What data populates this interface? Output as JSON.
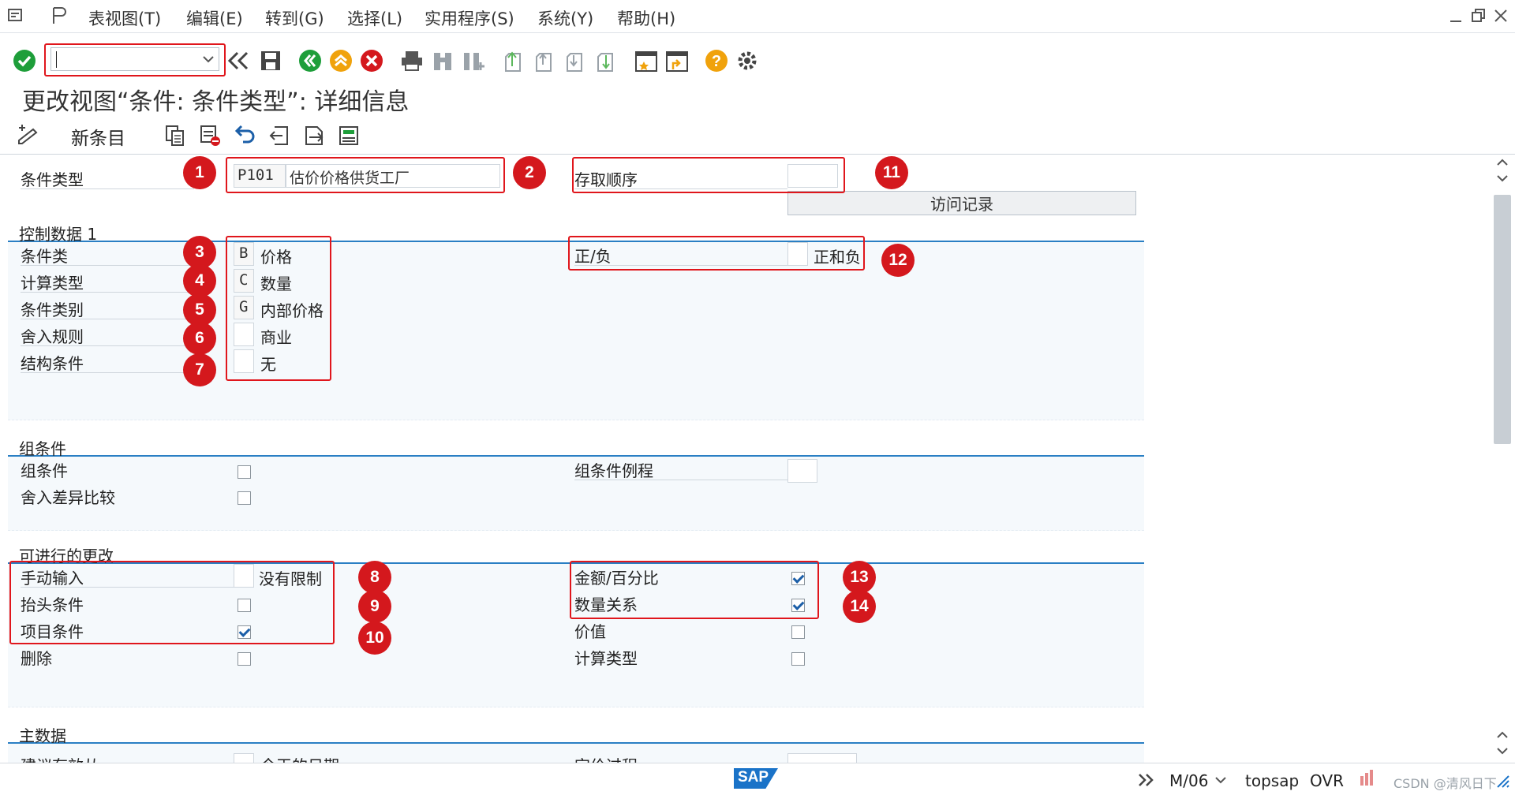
{
  "menubar": {
    "items": [
      "表视图(T)",
      "编辑(E)",
      "转到(G)",
      "选择(L)",
      "实用程序(S)",
      "系统(Y)",
      "帮助(H)"
    ]
  },
  "toolbar": {
    "icons": [
      "check-icon",
      "back-icon",
      "save-icon",
      "nav-back-icon",
      "exit-icon",
      "cancel-icon",
      "print-icon",
      "find-icon",
      "find-next-icon",
      "first-page-icon",
      "prev-page-icon",
      "next-page-icon",
      "last-page-icon",
      "new-session-icon",
      "shortcut-icon",
      "help-icon",
      "settings-icon"
    ],
    "command_value": ""
  },
  "title": "更改视图“条件: 条件类型”: 详细信息",
  "app_toolbar": {
    "new_entry": "新条目"
  },
  "header_fields": {
    "condition_type_label": "条件类型",
    "condition_type_code": "P101",
    "condition_type_desc": "估价价格供货工厂",
    "access_seq_label": "存取顺序",
    "access_seq_value": "",
    "access_records_btn": "访问记录"
  },
  "control_data_1": {
    "title": "控制数据 1",
    "rows": [
      {
        "label": "条件类",
        "code": "B",
        "text": "价格"
      },
      {
        "label": "计算类型",
        "code": "C",
        "text": "数量"
      },
      {
        "label": "条件类别",
        "code": "G",
        "text": "内部价格"
      },
      {
        "label": "舍入规则",
        "code": "",
        "text": "商业"
      },
      {
        "label": "结构条件",
        "code": "",
        "text": "无"
      }
    ],
    "plus_minus_label": "正/负",
    "plus_minus_code": "",
    "plus_minus_text": "正和负"
  },
  "group_condition": {
    "title": "组条件",
    "group_cond_label": "组条件",
    "rounding_diff_label": "舍入差异比较",
    "group_routine_label": "组条件例程"
  },
  "changes": {
    "title": "可进行的更改",
    "manual_entry_label": "手动输入",
    "manual_entry_text": "没有限制",
    "header_cond_label": "抬头条件",
    "item_cond_label": "项目条件",
    "delete_label": "删除",
    "amount_pct_label": "金额/百分比",
    "qty_relation_label": "数量关系",
    "value_label": "价值",
    "calc_type_label": "计算类型"
  },
  "master_data": {
    "title": "主数据",
    "row_label_left": "建议有效从",
    "row_text_left": "今天的日期",
    "row_label_right": "定价过程"
  },
  "badges": [
    "1",
    "2",
    "3",
    "4",
    "5",
    "6",
    "7",
    "8",
    "9",
    "10",
    "11",
    "12",
    "13",
    "14"
  ],
  "statusbar": {
    "logo": "SAP",
    "session": "M/06",
    "server": "topsap",
    "mode": "OVR",
    "watermark": "CSDN @清风日下"
  },
  "colors": {
    "accent": "#2a7fc4",
    "annotation": "#d4181d"
  }
}
